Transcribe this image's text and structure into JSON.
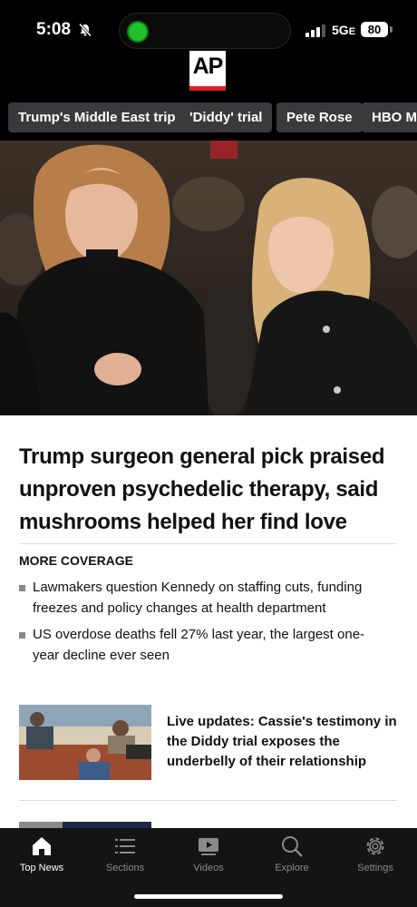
{
  "status_bar": {
    "time": "5:08",
    "network": "5G",
    "network_suffix": "E",
    "battery": "80"
  },
  "logo": {
    "text": "AP"
  },
  "topics": [
    "Trump's Middle East trip",
    "'Diddy' trial",
    "Pete Rose",
    "HBO Ma"
  ],
  "hero": {
    "icon": "photo-two-women"
  },
  "main_story": {
    "headline": "Trump surgeon general pick praised unproven psychedelic therapy, said mushrooms helped her find love",
    "more_coverage_label": "MORE COVERAGE",
    "related": [
      "Lawmakers question Kennedy on staffing cuts, funding freezes and policy changes at health department",
      "US overdose deaths fell 27% last year, the largest one-year decline ever seen"
    ]
  },
  "secondary_story": {
    "title": "Live updates: Cassie's testimony in the Diddy trial exposes the underbelly of their relationship",
    "thumbnail": "courtroom-sketch"
  },
  "tabbar": {
    "tabs": [
      {
        "label": "Top News",
        "icon": "house-icon",
        "active": true
      },
      {
        "label": "Sections",
        "icon": "list-icon",
        "active": false
      },
      {
        "label": "Videos",
        "icon": "video-icon",
        "active": false
      },
      {
        "label": "Explore",
        "icon": "search-icon",
        "active": false
      },
      {
        "label": "Settings",
        "icon": "gear-icon",
        "active": false
      }
    ]
  },
  "colors": {
    "accent_red": "#e02020",
    "chip_bg": "#3a3a3c",
    "tabbar_bg": "#141414"
  }
}
